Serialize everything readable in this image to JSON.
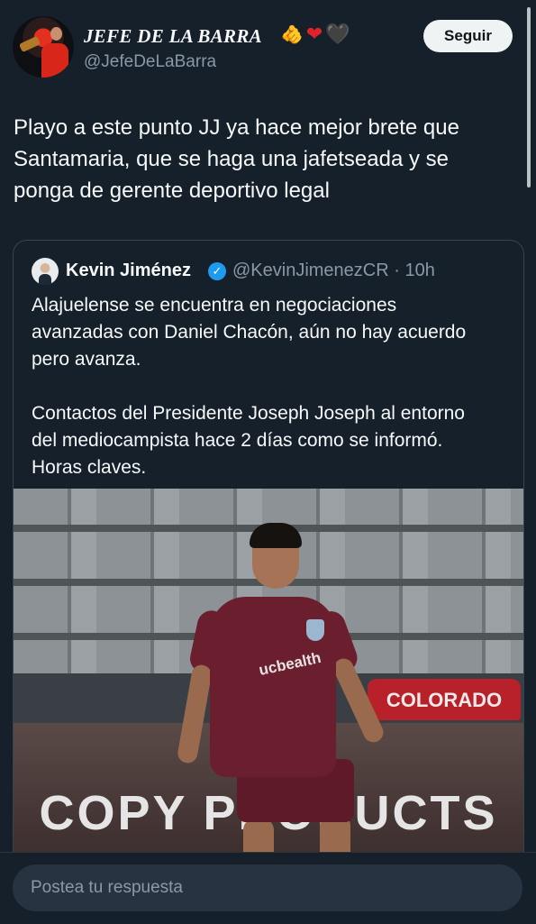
{
  "author": {
    "display_name": "JEFE DE LA BARRA",
    "emojis": [
      "🫵",
      "❤",
      "🖤"
    ],
    "handle": "@JefeDeLaBarra"
  },
  "follow_button": {
    "label": "Seguir"
  },
  "tweet": {
    "lines": [
      "Playo a este punto JJ ya hace mejor brete que",
      "Santamaria, que se haga una jafetseada y se",
      "ponga de gerente deportivo legal"
    ]
  },
  "quote": {
    "name": "Kevin Jiménez",
    "verified": true,
    "handle_time": "@KevinJimenezCR · 10h",
    "paragraph1": [
      "Alajuelense se encuentra en negociaciones",
      "avanzadas con Daniel Chacón, aún no hay acuerdo",
      "pero avanza."
    ],
    "paragraph2": [
      "Contactos del Presidente Joseph Joseph al entorno",
      "del mediocampista hace 2 días como se informó.",
      "Horas claves."
    ],
    "media": {
      "sponsor": "ucbealth",
      "banner": "COLORADO",
      "board": "COPY PRODUCTS"
    }
  },
  "reply": {
    "placeholder": "Postea tu respuesta"
  },
  "colors": {
    "background": "#15202b",
    "accent": "#1d9bf0",
    "muted": "#8b98a5"
  }
}
